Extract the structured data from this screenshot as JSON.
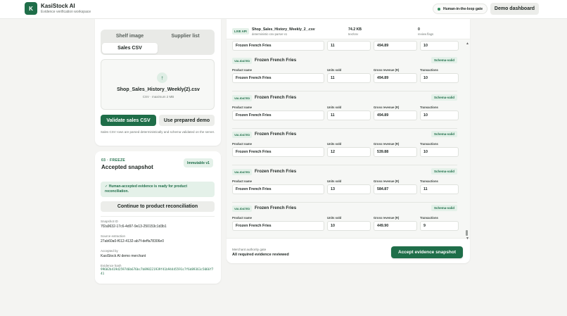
{
  "header": {
    "logo_letter": "K",
    "app_title": "KasiStock AI",
    "app_subtitle": "Evidence verification workspace",
    "hitl_label": "Human-in-the-loop gate",
    "demo_button": "Demo dashboard"
  },
  "upload": {
    "tabs": [
      "Shelf image",
      "Supplier list",
      "Sales CSV"
    ],
    "active_tab": "Sales CSV",
    "upload_icon": "arrow-up-icon",
    "file_name": "Shop_Sales_History_Weekly(2).csv",
    "file_meta": "CSV · maximum 2 MB",
    "validate_button": "Validate sales CSV",
    "prepared_button": "Use prepared demo",
    "hint": "Sales CSV rows are parsed deterministically and schema validated on the server."
  },
  "snapshot": {
    "step_label": "03 · FREEZE",
    "title": "Accepted snapshot",
    "badge": "Immutable v1",
    "ready_message": "✓ Human-accepted evidence is ready for product reconciliation.",
    "continue_button": "Continue to product reconciliation",
    "snapshot_id_label": "Snapshot ID",
    "snapshot_id": "7f2a9632-17c6-4d97-9e13-250153c1d3b1",
    "source_label": "Source extraction",
    "source": "27ab60a0-f612-4132-ab7f-deffa78306e0",
    "accepted_by_label": "Accepted by",
    "accepted_by": "KasiStock AI demo merchant",
    "hash_label": "Evidence hash",
    "hash": "99602b419d259746b676bc7b898221939f41b94445591c7f6d89361c5066f741"
  },
  "file_strip": {
    "badge": "LIVE API",
    "file": "Shop_Sales_History_Weekly_2_.csv",
    "parser": "deterministic-csv-parser-v1",
    "size": "74.2 KB",
    "size_label": "text/csv",
    "flags": "0",
    "flags_label": "review flags"
  },
  "field_labels": {
    "product": "Product name",
    "units": "Units sold",
    "revenue": "Gross revenue (R)",
    "transactions": "Transactions"
  },
  "partial_row": {
    "product": "Frozen French Fries",
    "units": "11",
    "revenue": "494.89",
    "transactions": "10"
  },
  "rows": [
    {
      "badge": "VALIDATED",
      "title": "Frozen French Fries",
      "schema": "Schema-valid",
      "product": "Frozen French Fries",
      "units": "11",
      "revenue": "494.89",
      "transactions": "10"
    },
    {
      "badge": "VALIDATED",
      "title": "Frozen French Fries",
      "schema": "Schema-valid",
      "product": "Frozen French Fries",
      "units": "11",
      "revenue": "494.89",
      "transactions": "10"
    },
    {
      "badge": "VALIDATED",
      "title": "Frozen French Fries",
      "schema": "Schema-valid",
      "product": "Frozen French Fries",
      "units": "12",
      "revenue": "539.88",
      "transactions": "10"
    },
    {
      "badge": "VALIDATED",
      "title": "Frozen French Fries",
      "schema": "Schema-valid",
      "product": "Frozen French Fries",
      "units": "13",
      "revenue": "584.87",
      "transactions": "11"
    },
    {
      "badge": "VALIDATED",
      "title": "Frozen French Fries",
      "schema": "Schema-valid",
      "product": "Frozen French Fries",
      "units": "10",
      "revenue": "449.90",
      "transactions": "9"
    }
  ],
  "footer": {
    "label": "Merchant authority gate",
    "status": "All required evidence reviewed",
    "accept_button": "Accept evidence snapshot"
  },
  "colors": {
    "brand_green": "#1f6e49",
    "badge_green_bg": "#e4f1e9"
  }
}
